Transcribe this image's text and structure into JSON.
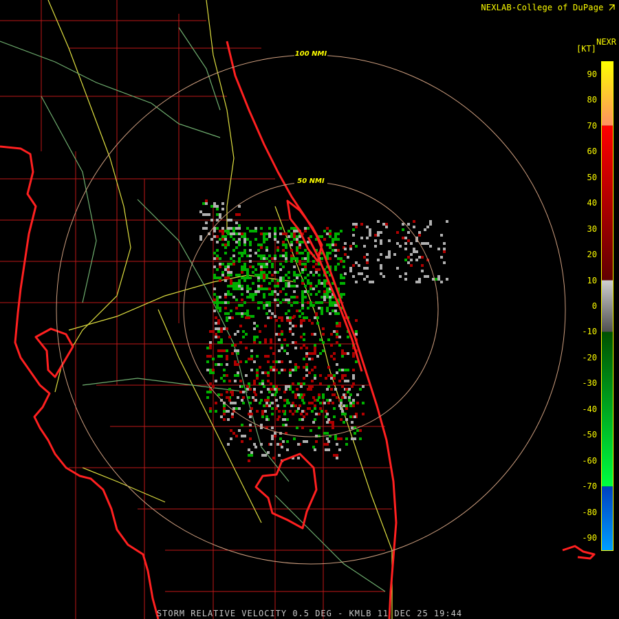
{
  "header": {
    "credit": "NEXLAB-College of DuPage",
    "credit_icon": "arrow-logo-icon",
    "product": "NEXR",
    "unit": "[KT]"
  },
  "footer": {
    "caption": "STORM RELATIVE VELOCITY 0.5 DEG - KMLB 11 DEC 25 19:44"
  },
  "radar": {
    "site": "KMLB",
    "rings": [
      {
        "label": "100 NMI"
      },
      {
        "label": "50 NMI"
      }
    ]
  },
  "legend": {
    "ticks": [
      {
        "value": 90,
        "label": "90"
      },
      {
        "value": 80,
        "label": "80"
      },
      {
        "value": 70,
        "label": "70"
      },
      {
        "value": 60,
        "label": "60"
      },
      {
        "value": 50,
        "label": "50"
      },
      {
        "value": 40,
        "label": "40"
      },
      {
        "value": 30,
        "label": "30"
      },
      {
        "value": 20,
        "label": "20"
      },
      {
        "value": 10,
        "label": "10"
      },
      {
        "value": 0,
        "label": "0"
      },
      {
        "value": -10,
        "label": "-10"
      },
      {
        "value": -20,
        "label": "-20"
      },
      {
        "value": -30,
        "label": "-30"
      },
      {
        "value": -40,
        "label": "-40"
      },
      {
        "value": -50,
        "label": "-50"
      },
      {
        "value": -60,
        "label": "-60"
      },
      {
        "value": -70,
        "label": "-70"
      },
      {
        "value": -80,
        "label": "-80"
      },
      {
        "value": -90,
        "label": "-90"
      }
    ],
    "range": [
      -95,
      95
    ],
    "bands": [
      {
        "from": 95,
        "to": 70,
        "color": "#ffff00",
        "color2": "#ff9060"
      },
      {
        "from": 70,
        "to": 10,
        "color": "#ff0000",
        "color2": "#600000"
      },
      {
        "from": 10,
        "to": -10,
        "color": "#d0d0d0",
        "color2": "#505050"
      },
      {
        "from": -10,
        "to": -70,
        "color": "#005000",
        "color2": "#00ff40"
      },
      {
        "from": -70,
        "to": -95,
        "color": "#0040c0",
        "color2": "#00a0ff"
      }
    ]
  },
  "colors": {
    "coast": "#ff2020",
    "county": "#c01818",
    "road": "#e0e040",
    "minor_road": "#70b070",
    "ring": "#d0a080",
    "inbound": "#00b000",
    "outbound": "#b00000",
    "near_zero": "#b0b0b0"
  }
}
